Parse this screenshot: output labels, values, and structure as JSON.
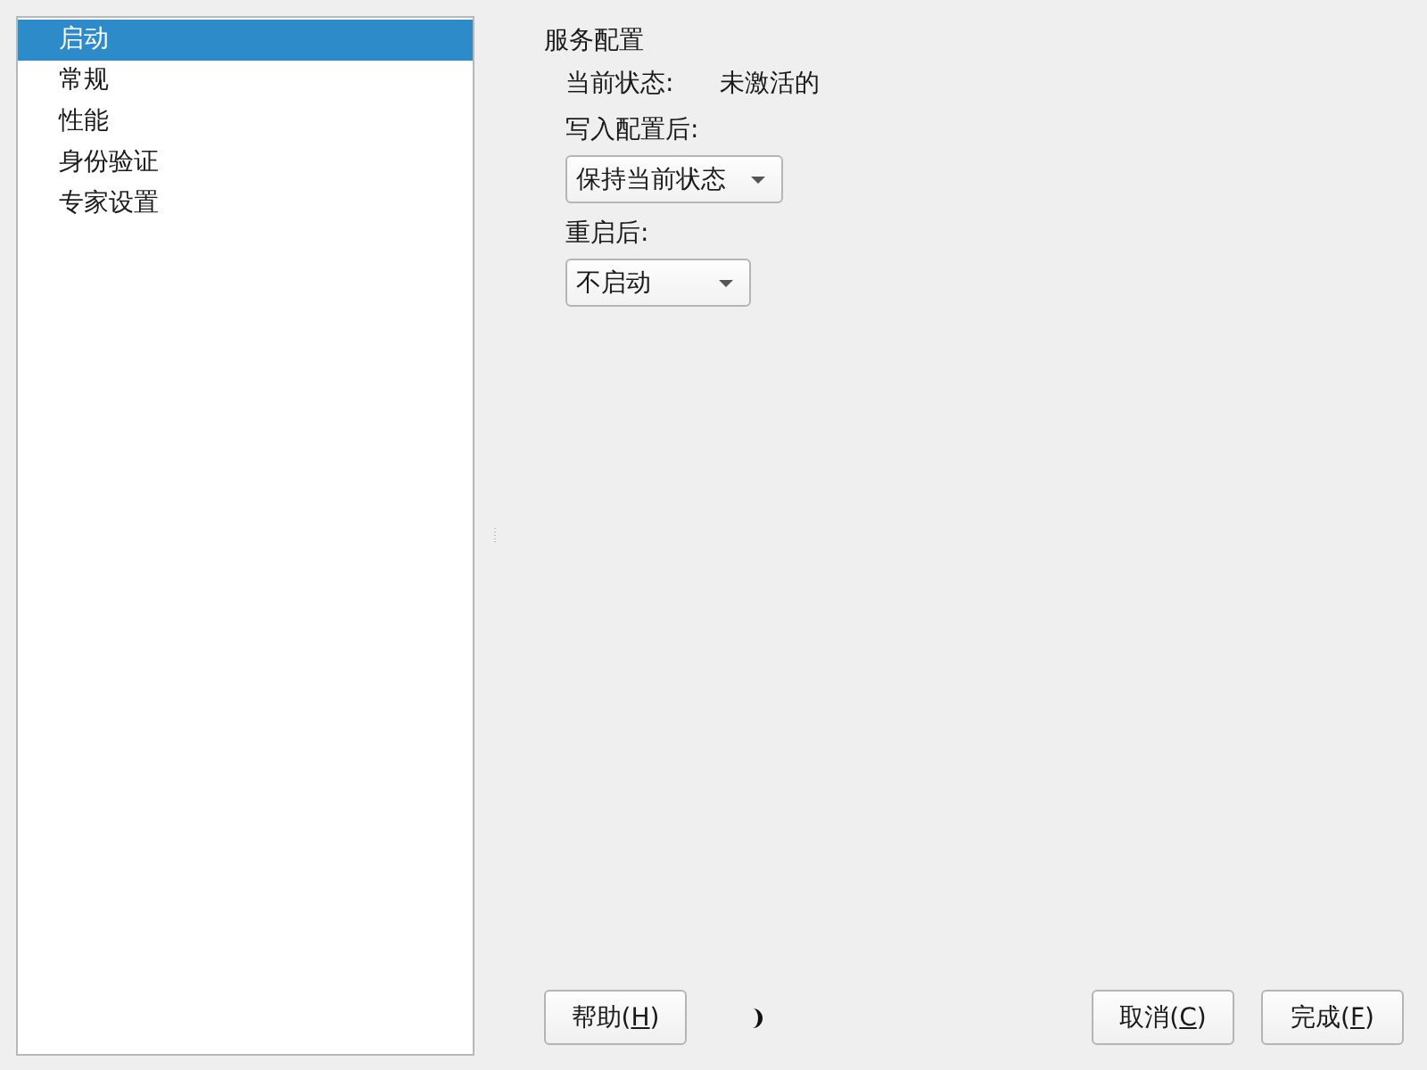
{
  "sidebar": {
    "items": [
      {
        "label": "启动",
        "selected": true
      },
      {
        "label": "常规",
        "selected": false
      },
      {
        "label": "性能",
        "selected": false
      },
      {
        "label": "身份验证",
        "selected": false
      },
      {
        "label": "专家设置",
        "selected": false
      }
    ]
  },
  "panel": {
    "title": "服务配置",
    "status_label": "当前状态:",
    "status_value": "未激活的",
    "fields": [
      {
        "label": "写入配置后:",
        "value": "保持当前状态"
      },
      {
        "label": "重启后:",
        "value": "不启动"
      }
    ]
  },
  "buttons": {
    "help": {
      "label": "帮助(",
      "mnemonic": "H",
      "label_end": ")"
    },
    "cancel": {
      "label": "取消(",
      "mnemonic": "C",
      "label_end": ")"
    },
    "finish": {
      "label": "完成(",
      "mnemonic": "F",
      "label_end": ")"
    }
  }
}
